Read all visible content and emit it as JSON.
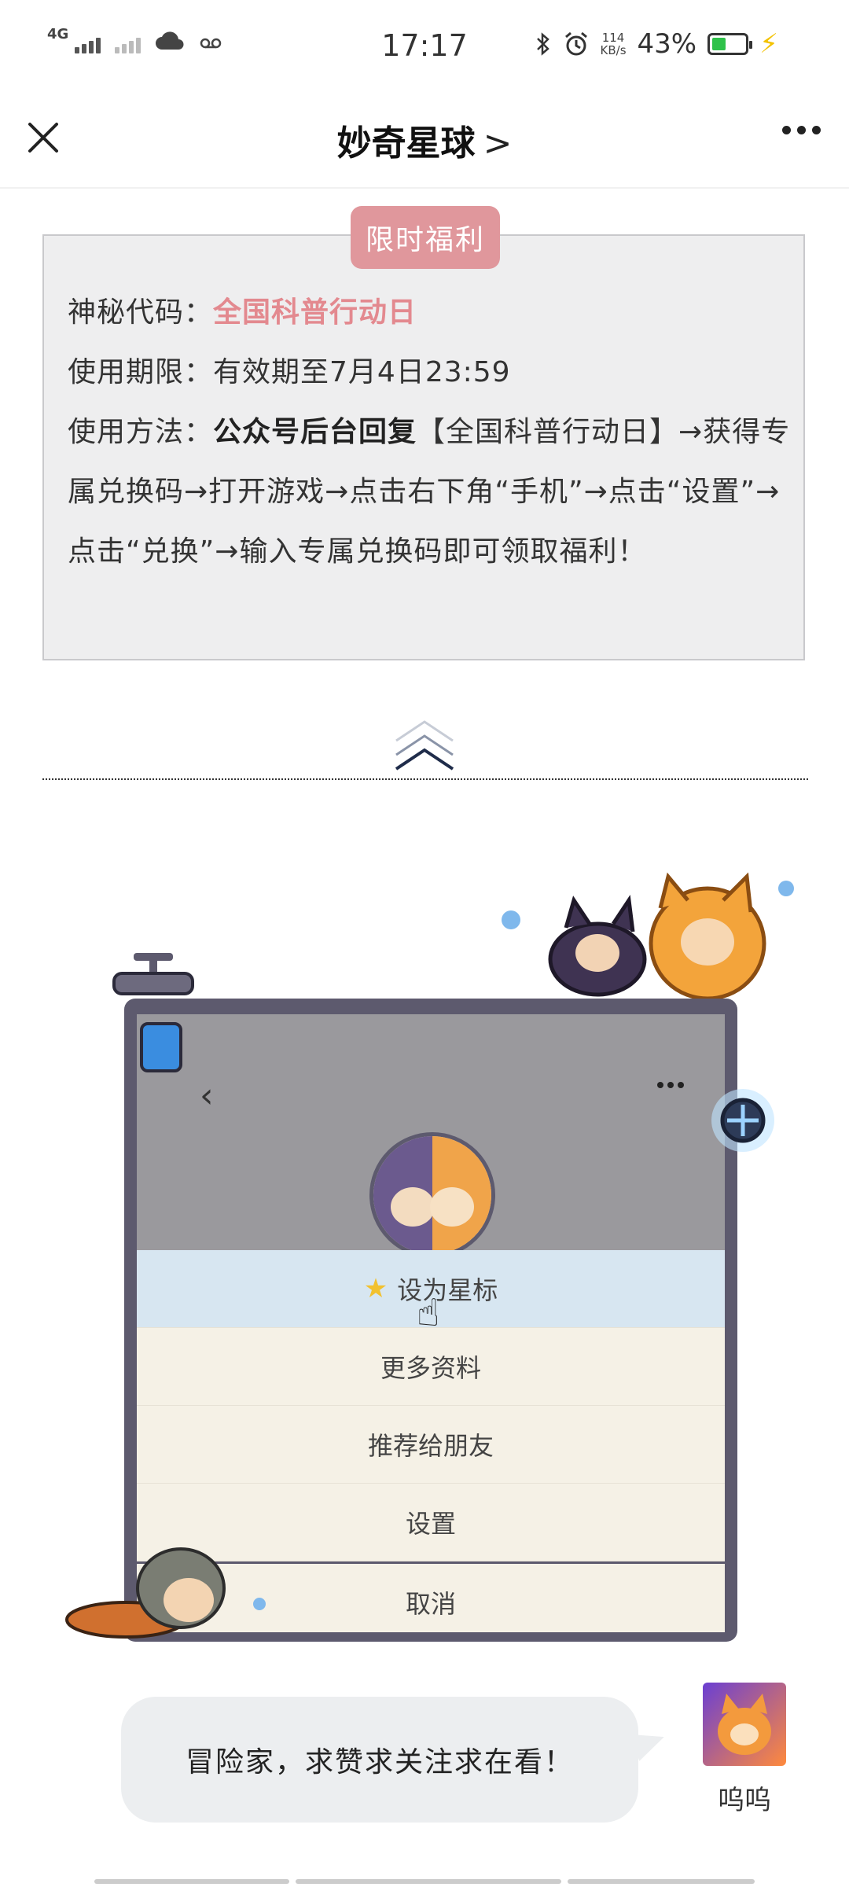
{
  "status_bar": {
    "network": "4G",
    "time": "17:17",
    "speed_value": "114",
    "speed_unit": "KB/s",
    "battery": "43%",
    "battery_level": 0.43
  },
  "nav": {
    "title": "妙奇星球",
    "chevron": ">"
  },
  "promo": {
    "tag": "限时福利",
    "code_label": "神秘代码：",
    "code_value": "全国科普行动日",
    "period_label": "使用期限：",
    "period_value": "有效期至7月4日23:59",
    "method_label": "使用方法：",
    "method_bold": "公众号后台回复",
    "method_text": "【全国科普行动日】→获得专属兑换码→打开游戏→点击右下角“手机”→点击“设置”→点击“兑换”→输入专属兑换码即可领取福利！"
  },
  "illustration": {
    "menu_items": [
      "设为星标",
      "更多资料",
      "推荐给朋友",
      "设置",
      "取消"
    ]
  },
  "comment": {
    "text": "冒险家，求赞求关注求在看！",
    "author": "呜呜"
  }
}
